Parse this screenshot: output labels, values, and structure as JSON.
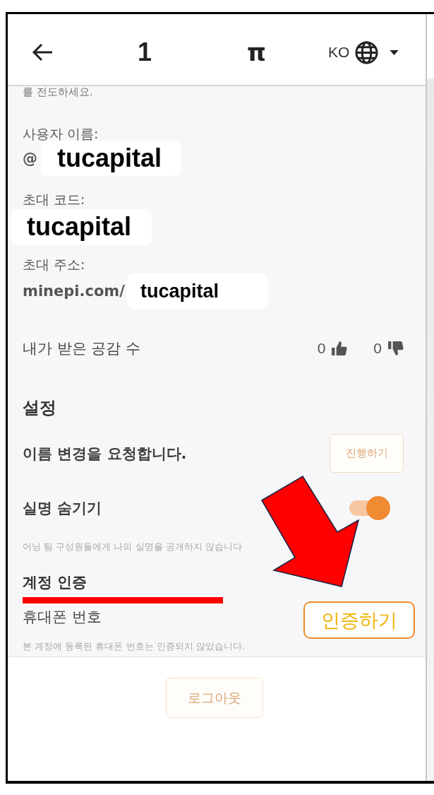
{
  "header": {
    "title": "1",
    "logo": "π",
    "language": "KO"
  },
  "profile": {
    "intro_text": "를 전도하세요.",
    "fields": [
      {
        "label": "사용자 이름:",
        "prefix": "@",
        "value": "tucapital"
      },
      {
        "label": "초대 코드:",
        "value": "tucapital"
      },
      {
        "label": "초대 주소:",
        "prefix": "minepi.com/",
        "value": "tucapital"
      }
    ]
  },
  "reactions": {
    "label": "내가 받은 공감 수",
    "likes": "0",
    "dislikes": "0"
  },
  "settings": {
    "title": "설정",
    "items": [
      {
        "kind": "button",
        "label": "이름 변경을 요청합니다.",
        "button": "진행하기"
      },
      {
        "kind": "toggle",
        "label": "실명 숨기기",
        "on": true,
        "description": "어닝 팀 구성원들에게 나의 실명을 공개하지 않습니다"
      }
    ]
  },
  "verification": {
    "title": "계정 인증",
    "underlined": true,
    "items": [
      {
        "kind": "button",
        "label": "휴대폰 번호",
        "button": "인증하기",
        "description": "본 계정에 등록된 휴대폰 번호는 인증되지 않았습니다."
      }
    ]
  },
  "logout_button": "로그아웃",
  "annotations": [
    {
      "kind": "arrow"
    }
  ]
}
